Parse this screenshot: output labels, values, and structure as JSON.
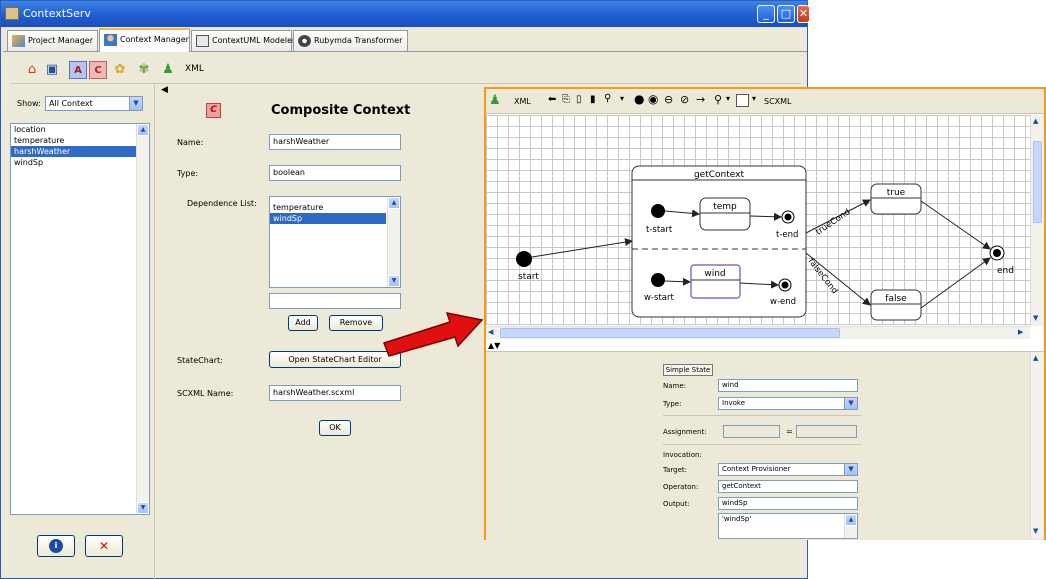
{
  "app": {
    "title": "ContextServ"
  },
  "tabs": [
    {
      "label": "Project Manager",
      "icon": "project-manager-icon"
    },
    {
      "label": "Context Manager",
      "icon": "context-manager-icon"
    },
    {
      "label": "ContextUML Modeler",
      "icon": "uml-modeler-icon"
    },
    {
      "label": "Rubymda Transformer",
      "icon": "gear-icon"
    }
  ],
  "toolbar": {
    "xml_label": "XML",
    "icons": [
      "home-icon",
      "save-icon",
      "atomic-context-icon",
      "composite-context-icon",
      "context-group-icon",
      "context-set-icon",
      "user-icon"
    ]
  },
  "leftpanel": {
    "show_label": "Show:",
    "show_value": "All Context",
    "items": [
      "location",
      "temperature",
      "harshWeather",
      "windSp"
    ],
    "selected_index": 2
  },
  "form": {
    "heading": "Composite Context",
    "badge": "C",
    "name_label": "Name:",
    "name_value": "harshWeather",
    "type_label": "Type:",
    "type_value": "boolean",
    "dep_label": "Dependence List:",
    "dep_items": [
      "temperature",
      "windSp"
    ],
    "dep_selected": 1,
    "dep_input": "",
    "add_label": "Add",
    "remove_label": "Remove",
    "statechart_label": "StateChart:",
    "statechart_button": "Open StateChart Editor",
    "scxml_label": "SCXML Name:",
    "scxml_value": "harshWeather.scxml",
    "ok_label": "OK"
  },
  "editor": {
    "xml_label": "XML",
    "scxml_label": "SCXML",
    "diagram": {
      "composite": "getContext",
      "start": "start",
      "tstart": "t-start",
      "temp": "temp",
      "tend": "t-end",
      "wstart": "w-start",
      "wind": "wind",
      "wend": "w-end",
      "true_state": "true",
      "false_state": "false",
      "end": "end",
      "trueCond": "trueCond",
      "falseCond": "falseCond"
    },
    "props": {
      "title": "Simple State",
      "name_label": "Name:",
      "name_value": "wind",
      "type_label": "Type:",
      "type_value": "Invoke",
      "assign_label": "Assignment:",
      "assign_left": "",
      "assign_op": "=",
      "assign_right": "",
      "invocation_label": "Invocation:",
      "target_label": "Target:",
      "target_value": "Context Provisioner",
      "operation_label": "Operaton:",
      "operation_value": "getContext",
      "output_label": "Output:",
      "output_value": "windSp",
      "output_list": "'windSp'"
    }
  },
  "colors": {
    "arrow": "#e01010",
    "editor_border": "#f39a1a",
    "selection": "#316ac5"
  }
}
